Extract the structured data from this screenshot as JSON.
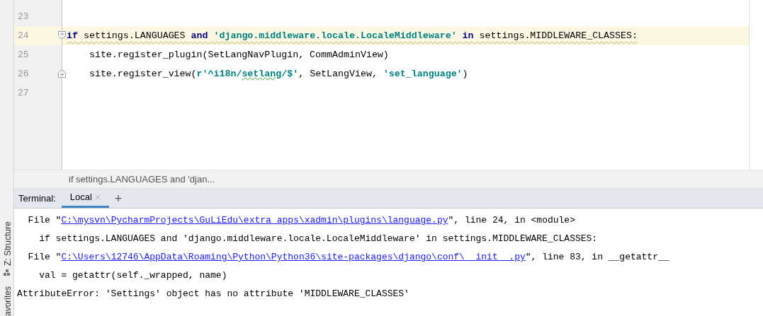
{
  "side_strip": {
    "items": [
      {
        "label": "Z: Structure",
        "kind": "structure"
      },
      {
        "label": "avorites",
        "kind": "favorites"
      }
    ]
  },
  "editor": {
    "lines": [
      {
        "number": "23",
        "kind": "plain",
        "current": false
      },
      {
        "number": "24",
        "kind": "opener",
        "current": true,
        "warning": true,
        "segments": [
          {
            "text": "if",
            "kind": "keyword",
            "spell": false
          },
          {
            "text": " settings.LANGUAGES ",
            "kind": "plain",
            "spell": false
          },
          {
            "text": "and",
            "kind": "keyword",
            "spell": false
          },
          {
            "text": " 'django.middleware.locale.LocaleMiddleware' ",
            "kind": "string",
            "spell": false
          },
          {
            "text": "in",
            "kind": "keyword",
            "spell": false
          },
          {
            "text": " settings.MIDDLEWARE_CLASSES:",
            "kind": "plain",
            "spell": false
          }
        ]
      },
      {
        "number": "25",
        "kind": "plain",
        "current": false,
        "warning": false,
        "segments": [
          {
            "text": "    site.register_plugin(SetLangNavPlugin, CommAdminView)",
            "kind": "plain",
            "spell": false
          }
        ]
      },
      {
        "number": "26",
        "kind": "closer",
        "current": false,
        "warning": false,
        "segments": [
          {
            "text": "    site.register_view(",
            "kind": "plain",
            "spell": false
          },
          {
            "text": "r'^i18n/",
            "kind": "string",
            "spell": false
          },
          {
            "text": "setlang",
            "kind": "string",
            "spell": true
          },
          {
            "text": "/$'",
            "kind": "string",
            "spell": false
          },
          {
            "text": ", SetLangView, ",
            "kind": "plain",
            "spell": false
          },
          {
            "text": "'set_language'",
            "kind": "string",
            "spell": false
          },
          {
            "text": ")",
            "kind": "plain",
            "spell": false
          }
        ]
      },
      {
        "number": "27",
        "kind": "plain",
        "current": false
      }
    ]
  },
  "breadcrumb": "if settings.LANGUAGES and 'djan...",
  "terminal": {
    "label": "Terminal:",
    "tabs": [
      {
        "label": "Local",
        "selected": true,
        "closable": true
      }
    ],
    "add_button": "+",
    "lines": [
      {
        "segments": [
          {
            "text": "  File \"",
            "kind": "plain"
          },
          {
            "text": "C:\\mysvn\\PycharmProjects\\GuLiEdu\\extra_apps\\xadmin\\plugins\\language.py",
            "kind": "link"
          },
          {
            "text": "\", line 24, in <module>",
            "kind": "plain"
          }
        ]
      },
      {
        "segments": [
          {
            "text": "    if settings.LANGUAGES and 'django.middleware.locale.LocaleMiddleware' in settings.MIDDLEWARE_CLASSES:",
            "kind": "plain"
          }
        ]
      },
      {
        "segments": [
          {
            "text": "  File \"",
            "kind": "plain"
          },
          {
            "text": "C:\\Users\\12746\\AppData\\Roaming\\Python\\Python36\\site-packages\\django\\conf\\__init__.py",
            "kind": "link"
          },
          {
            "text": "\", line 83, in __getattr__",
            "kind": "plain"
          }
        ]
      },
      {
        "segments": [
          {
            "text": "    val = getattr(self._wrapped, name)",
            "kind": "plain"
          }
        ]
      },
      {
        "segments": [
          {
            "text": "AttributeError: 'Settings' object has no attribute 'MIDDLEWARE_CLASSES'",
            "kind": "plain"
          }
        ]
      }
    ]
  }
}
